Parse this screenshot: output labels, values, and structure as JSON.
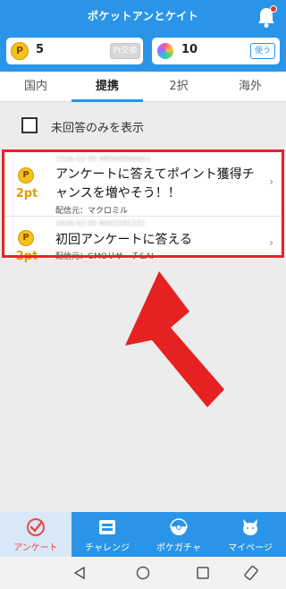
{
  "header": {
    "app_title": "ポケットアンとケイト",
    "points_icon": "P",
    "points": "5",
    "exchange_button": "Pt交換",
    "gems": "10",
    "use_button": "使う"
  },
  "tabs": [
    {
      "label": "国内"
    },
    {
      "label": "提携"
    },
    {
      "label": "2択"
    },
    {
      "label": "海外"
    }
  ],
  "filter": {
    "label": "未回答のみを表示"
  },
  "surveys": [
    {
      "coin": "P",
      "points": "2pt",
      "meta": "2026-02-05 MK000000001",
      "title": "アンケートに答えてポイント獲得チャンスを増やそう！！",
      "sender": "配信元：マクロミル"
    },
    {
      "coin": "P",
      "points": "2pt",
      "meta": "2026-02-05 R002291231",
      "title": "初回アンケートに答える",
      "sender": "配信元：GMOリサーチ&AI"
    }
  ],
  "bottom_nav": [
    {
      "label": "アンケート",
      "icon": "survey-check-icon"
    },
    {
      "label": "チャレンジ",
      "icon": "challenge-icon"
    },
    {
      "label": "ポケガチャ",
      "icon": "gacha-icon"
    },
    {
      "label": "マイページ",
      "icon": "mypage-icon"
    }
  ],
  "colors": {
    "primary": "#2a95e8",
    "accent_red": "#e8232a",
    "coin": "#f6c21b",
    "points_text": "#e89b00"
  }
}
